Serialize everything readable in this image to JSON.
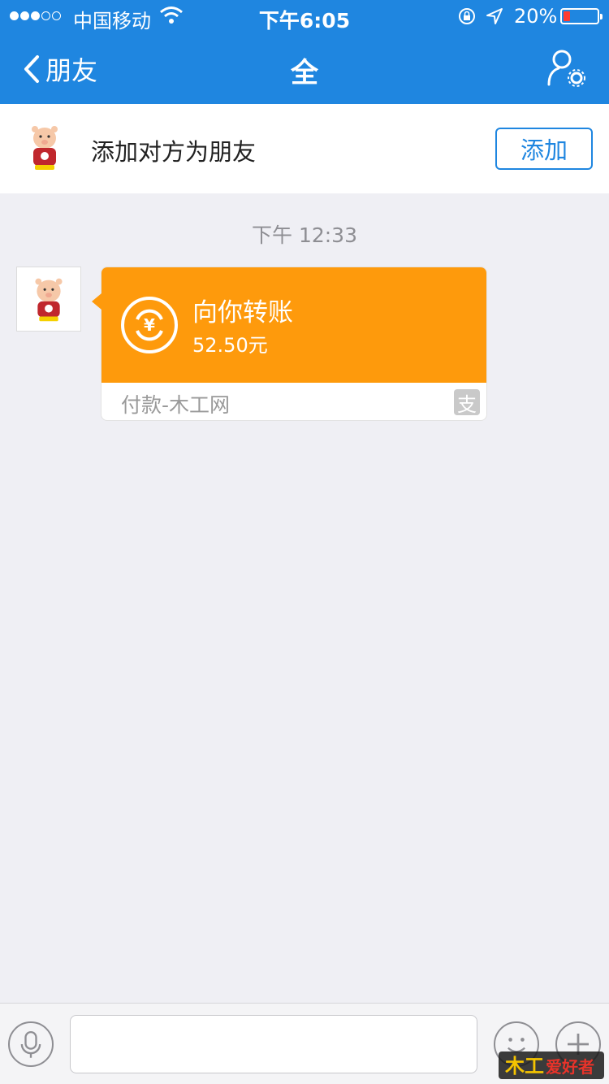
{
  "status_bar": {
    "carrier": "中国移动",
    "time": "下午6:05",
    "battery_percent_text": "20%",
    "battery_level": 0.2,
    "signal_bars_filled": 3,
    "signal_bars_total": 5
  },
  "nav": {
    "back_label": "朋友",
    "title": "全"
  },
  "add_friend": {
    "text": "添加对方为朋友",
    "button_label": "添加"
  },
  "chat": {
    "timestamp": "下午 12:33",
    "transfer_card": {
      "title": "向你转账",
      "amount": "52.50元",
      "source": "付款-木工网",
      "source_icon": "alipay-icon",
      "icon_glyph": "支"
    }
  },
  "input_bar": {
    "placeholder": ""
  },
  "watermark": {
    "text": "木工爱好者"
  },
  "colors": {
    "nav_blue": "#1f86e0",
    "card_orange": "#fe9a0c",
    "background": "#efeff4",
    "battery_red": "#ff3b30"
  }
}
